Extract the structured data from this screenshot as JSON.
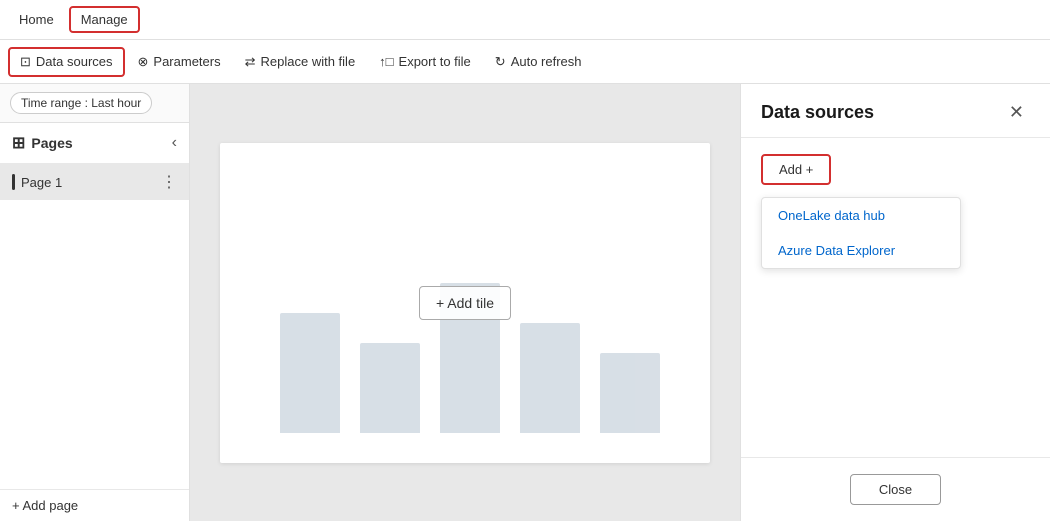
{
  "nav": {
    "home_label": "Home",
    "manage_label": "Manage"
  },
  "toolbar": {
    "data_sources_label": "Data sources",
    "parameters_label": "Parameters",
    "replace_with_file_label": "Replace with file",
    "export_to_file_label": "Export to file",
    "auto_refresh_label": "Auto refresh"
  },
  "time_range": {
    "label": "Time range : Last hour"
  },
  "pages": {
    "title": "Pages",
    "page1_label": "Page 1"
  },
  "canvas": {
    "add_tile_label": "+ Add tile"
  },
  "add_page": {
    "label": "+ Add page"
  },
  "right_panel": {
    "title": "Data sources",
    "add_button": "Add +",
    "menu_item1": "OneLake data hub",
    "menu_item2": "Azure Data Explorer",
    "close_button": "Close"
  }
}
